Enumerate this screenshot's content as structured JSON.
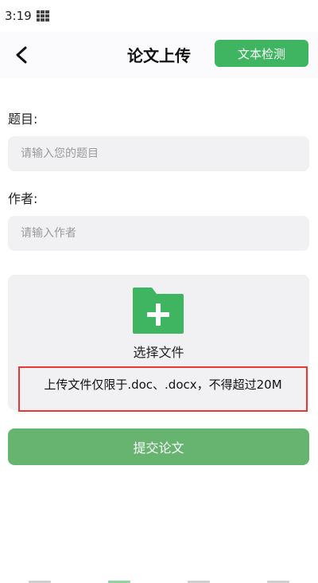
{
  "status_bar": {
    "time": "3:19"
  },
  "header": {
    "title": "论文上传",
    "action_label": "文本检测"
  },
  "form": {
    "title_label": "题目:",
    "title_placeholder": "请输入您的题目",
    "author_label": "作者:",
    "author_placeholder": "请输入作者"
  },
  "upload": {
    "choose_label": "选择文件",
    "notice": "上传文件仅限于.doc、.docx，不得超过20M"
  },
  "submit_label": "提交论文",
  "colors": {
    "accent": "#40b561",
    "submit": "#67b370",
    "notice_border": "#e53935"
  },
  "icons": {
    "back": "chevron-left-icon",
    "folder": "folder-plus-icon"
  }
}
